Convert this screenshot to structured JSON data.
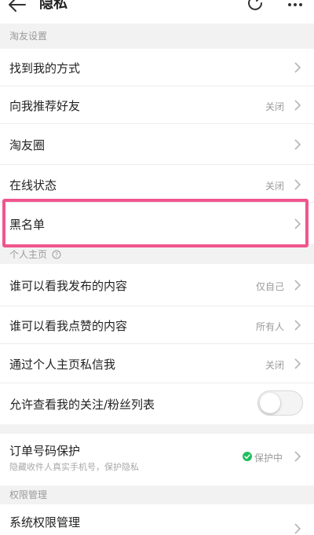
{
  "header": {
    "title": "隐私",
    "back_icon": "arrow-left-icon",
    "refresh_icon": "refresh-icon",
    "more_icon": "more-dots-icon",
    "badge_color": "#ff5a1f"
  },
  "sections": {
    "taoyou": "淘友设置",
    "profile": "个人主页",
    "permission": "权限管理"
  },
  "rows": {
    "find_me": {
      "label": "找到我的方式"
    },
    "recommend": {
      "label": "向我推荐好友",
      "value": "关闭"
    },
    "circle": {
      "label": "淘友圈"
    },
    "online": {
      "label": "在线状态",
      "value": "关闭"
    },
    "blacklist": {
      "label": "黑名单"
    },
    "who_posts": {
      "label": "谁可以看我发布的内容",
      "value": "仅自己"
    },
    "who_likes": {
      "label": "谁可以看我点赞的内容",
      "value": "所有人"
    },
    "dm": {
      "label": "通过个人主页私信我",
      "value": "关闭"
    },
    "follow_list": {
      "label": "允许查看我的关注/粉丝列表",
      "toggle_on": false
    },
    "order": {
      "label": "订单号码保护",
      "sub": "隐藏收件人真实手机号，保护隐私",
      "value": "保护中"
    },
    "sys_perm": {
      "label": "系统权限管理"
    }
  },
  "colors": {
    "highlight": "#f0558e",
    "protect_green": "#1fbf5f"
  }
}
